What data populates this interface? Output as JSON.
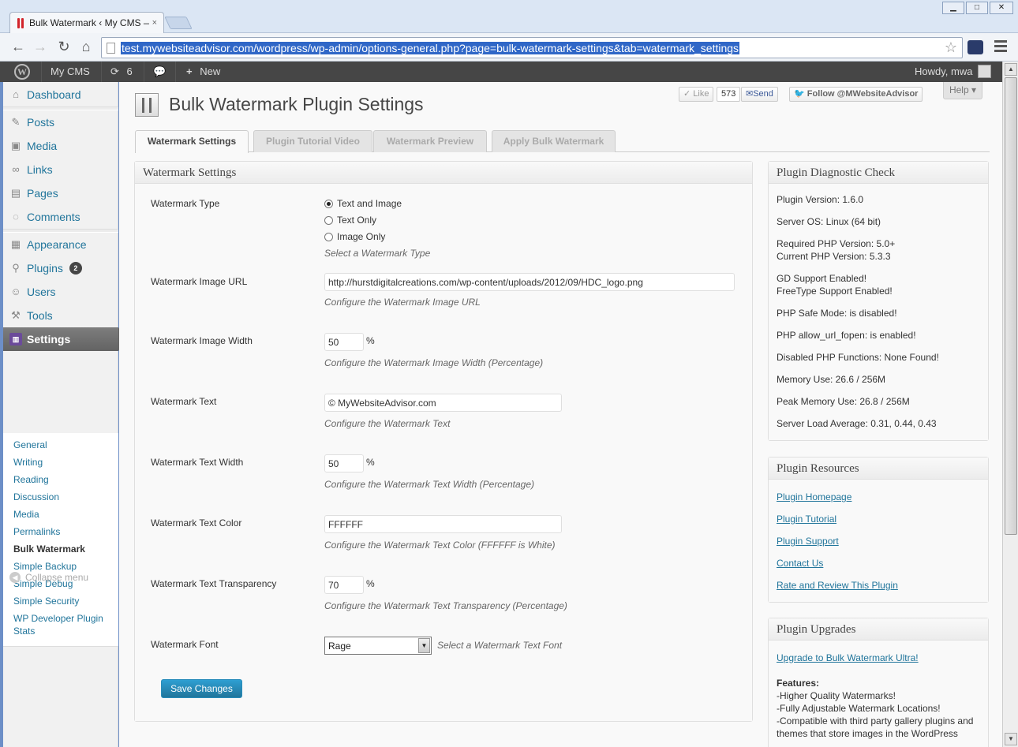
{
  "browser": {
    "tab_title": "Bulk Watermark ‹ My CMS —",
    "tab_close": "×",
    "url": "test.mywebsiteadvisor.com/wordpress/wp-admin/options-general.php?page=bulk-watermark-settings&tab=watermark_settings",
    "window_buttons": [
      "▁",
      "□",
      "✕"
    ]
  },
  "adminbar": {
    "site_name": "My CMS",
    "updates_count": "6",
    "new_label": "New",
    "howdy": "Howdy, mwa"
  },
  "sidebar": {
    "dashboard": "Dashboard",
    "posts": "Posts",
    "media": "Media",
    "links": "Links",
    "pages": "Pages",
    "comments": "Comments",
    "appearance": "Appearance",
    "plugins": "Plugins",
    "plugins_badge": "2",
    "users": "Users",
    "tools": "Tools",
    "settings": "Settings",
    "submenu": [
      "General",
      "Writing",
      "Reading",
      "Discussion",
      "Media",
      "Permalinks",
      "Bulk Watermark",
      "Simple Backup",
      "Simple Debug",
      "Simple Security",
      "WP Developer Plugin Stats"
    ],
    "collapse": "Collapse menu"
  },
  "page": {
    "title": "Bulk Watermark Plugin Settings",
    "like": "Like",
    "like_count": "573",
    "send": "Send",
    "follow": "Follow @MWebsiteAdvisor",
    "help": "Help"
  },
  "tabs": [
    "Watermark Settings",
    "Plugin Tutorial Video",
    "Watermark Preview",
    "Apply Bulk Watermark"
  ],
  "settings": {
    "box_title": "Watermark Settings",
    "type_label": "Watermark Type",
    "type_options": [
      "Text and Image",
      "Text Only",
      "Image Only"
    ],
    "type_selected": 0,
    "type_desc": "Select a Watermark Type",
    "image_url_label": "Watermark Image URL",
    "image_url_value": "http://hurstdigitalcreations.com/wp-content/uploads/2012/09/HDC_logo.png",
    "image_url_desc": "Configure the Watermark Image URL",
    "image_width_label": "Watermark Image Width",
    "image_width_value": "50",
    "image_width_desc": "Configure the Watermark Image Width (Percentage)",
    "text_label": "Watermark Text",
    "text_value": "© MyWebsiteAdvisor.com",
    "text_desc": "Configure the Watermark Text",
    "text_width_label": "Watermark Text Width",
    "text_width_value": "50",
    "text_width_desc": "Configure the Watermark Text Width (Percentage)",
    "text_color_label": "Watermark Text Color",
    "text_color_value": "FFFFFF",
    "text_color_desc": "Configure the Watermark Text Color (FFFFFF is White)",
    "transparency_label": "Watermark Text Transparency",
    "transparency_value": "70",
    "transparency_desc": "Configure the Watermark Text Transparency (Percentage)",
    "font_label": "Watermark Font",
    "font_value": "Rage",
    "font_desc": "Select a Watermark Text Font",
    "percent": "%",
    "save": "Save Changes"
  },
  "diagnostic": {
    "title": "Plugin Diagnostic Check",
    "lines": [
      [
        "Plugin Version: 1.6.0"
      ],
      [
        "Server OS: Linux (64 bit)"
      ],
      [
        "Required PHP Version: 5.0+",
        "Current PHP Version: 5.3.3"
      ],
      [
        "GD Support Enabled!",
        "FreeType Support Enabled!"
      ],
      [
        "PHP Safe Mode: is disabled!"
      ],
      [
        "PHP allow_url_fopen: is enabled!"
      ],
      [
        "Disabled PHP Functions: None Found!"
      ],
      [
        "Memory Use: 26.6 / 256M"
      ],
      [
        "Peak Memory Use: 26.8 / 256M"
      ],
      [
        "Server Load Average: 0.31, 0.44, 0.43"
      ]
    ]
  },
  "resources": {
    "title": "Plugin Resources",
    "links": [
      "Plugin Homepage",
      "Plugin Tutorial",
      "Plugin Support",
      "Contact Us",
      "Rate and Review This Plugin"
    ]
  },
  "upgrades": {
    "title": "Plugin Upgrades",
    "link": "Upgrade to Bulk Watermark Ultra!",
    "features_label": "Features:",
    "features": [
      "-Higher Quality Watermarks!",
      "-Fully Adjustable Watermark Locations!",
      "-Compatible with third party gallery plugins and themes that store images in the WordPress"
    ]
  }
}
